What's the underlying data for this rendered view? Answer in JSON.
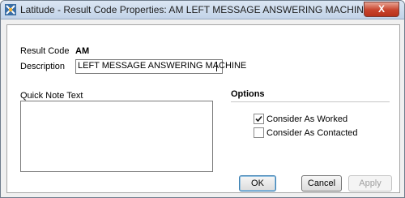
{
  "window": {
    "title": "Latitude - Result Code Properties: AM LEFT MESSAGE ANSWERING MACHINE",
    "close_label": "X"
  },
  "form": {
    "result_code_label": "Result Code",
    "result_code_value": "AM",
    "description_label": "Description",
    "description_value": "LEFT MESSAGE ANSWERING MACHINE",
    "quick_note_label": "Quick Note Text",
    "quick_note_value": ""
  },
  "options": {
    "title": "Options",
    "items": [
      {
        "label": "Consider As Worked",
        "checked": true
      },
      {
        "label": "Consider As Contacted",
        "checked": false
      }
    ]
  },
  "buttons": {
    "ok": "OK",
    "cancel": "Cancel",
    "apply": "Apply",
    "apply_enabled": false
  }
}
